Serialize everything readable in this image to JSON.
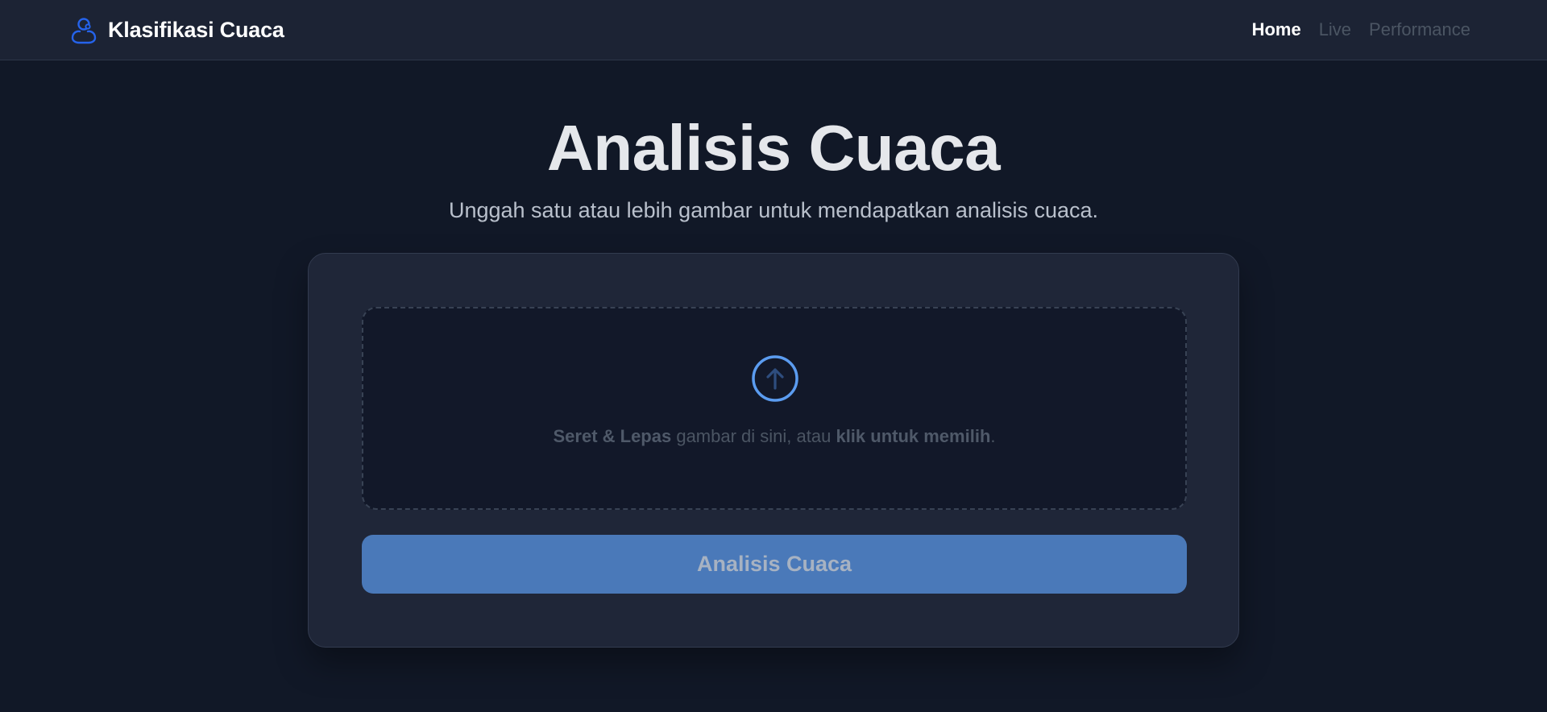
{
  "navbar": {
    "brand_title": "Klasifikasi Cuaca",
    "brand_icon": "person-location-icon",
    "links": [
      {
        "label": "Home",
        "active": true
      },
      {
        "label": "Live",
        "active": false
      },
      {
        "label": "Performance",
        "active": false
      }
    ]
  },
  "main": {
    "title": "Analisis Cuaca",
    "subtitle": "Unggah satu atau lebih gambar untuk mendapatkan analisis cuaca."
  },
  "dropzone": {
    "icon": "upload-arrow-icon",
    "text_bold_1": "Seret & Lepas",
    "text_middle": " gambar di sini, atau ",
    "text_bold_2": "klik untuk memilih",
    "text_end": "."
  },
  "analyze_button": {
    "label": "Analisis Cuaca"
  },
  "colors": {
    "background": "#111827",
    "navbar": "#1c2334",
    "card": "#1f2638",
    "dropzone": "#121829",
    "accent": "#4a79b9",
    "icon_accent": "#2563eb",
    "upload_ring": "#5b9cf0"
  }
}
